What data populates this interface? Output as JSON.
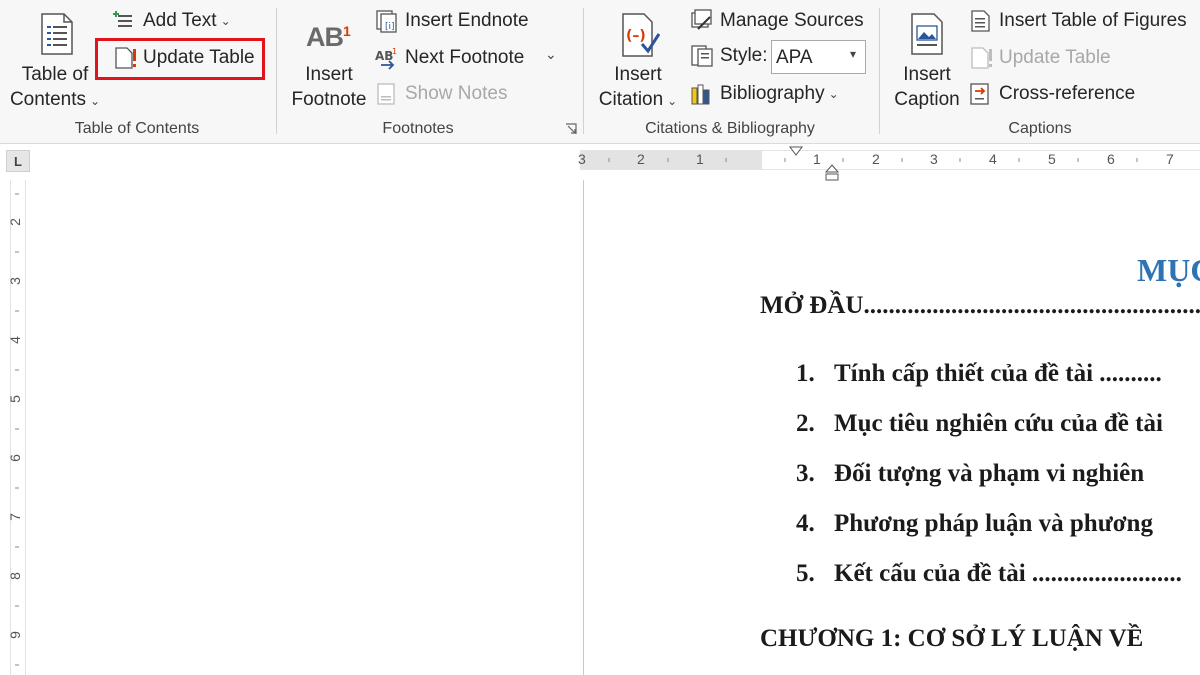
{
  "ribbon": {
    "toc_group": {
      "big_button": {
        "line1": "Table of",
        "line2": "Contents"
      },
      "add_text": "Add Text",
      "update_table": "Update Table",
      "label": "Table of Contents"
    },
    "footnotes_group": {
      "insert_footnote": {
        "line1": "Insert",
        "line2": "Footnote",
        "icon_text": "AB",
        "icon_sup": "1"
      },
      "insert_endnote": "Insert Endnote",
      "next_footnote": "Next Footnote",
      "show_notes": "Show Notes",
      "label": "Footnotes"
    },
    "citations_group": {
      "insert_citation": {
        "line1": "Insert",
        "line2": "Citation"
      },
      "manage_sources": "Manage Sources",
      "style_label": "Style:",
      "style_value": "APA",
      "bibliography": "Bibliography",
      "label": "Citations & Bibliography"
    },
    "captions_group": {
      "insert_caption": {
        "line1": "Insert",
        "line2": "Caption"
      },
      "insert_table_of_figures": "Insert Table of Figures",
      "update_table": "Update Table",
      "cross_reference": "Cross-reference",
      "label": "Captions"
    }
  },
  "ruler": {
    "top_numbers": [
      "3",
      "2",
      "1",
      "1",
      "2",
      "3",
      "4",
      "5",
      "6",
      "7"
    ],
    "left_numbers": [
      "2",
      "3",
      "4",
      "5",
      "6",
      "7",
      "8",
      "9"
    ]
  },
  "document": {
    "title_partial": "MỤC",
    "intro": "MỞ ĐẦU.......................................................................",
    "items": [
      {
        "num": "1.",
        "text": "Tính cấp thiết của đề tài .........."
      },
      {
        "num": "2.",
        "text": "Mục tiêu nghiên cứu của đề tài"
      },
      {
        "num": "3.",
        "text": "Đối tượng và phạm vi nghiên"
      },
      {
        "num": "4.",
        "text": "Phương pháp luận và phương"
      },
      {
        "num": "5.",
        "text": "Kết cấu của đề tài ........................"
      }
    ],
    "chapter1": "CHƯƠNG 1: CƠ SỞ LÝ LUẬN VỀ",
    "title_color": "#2e74b5"
  },
  "colors": {
    "highlight": "#e2131b",
    "ribbon_bg": "#f7f7f7"
  }
}
